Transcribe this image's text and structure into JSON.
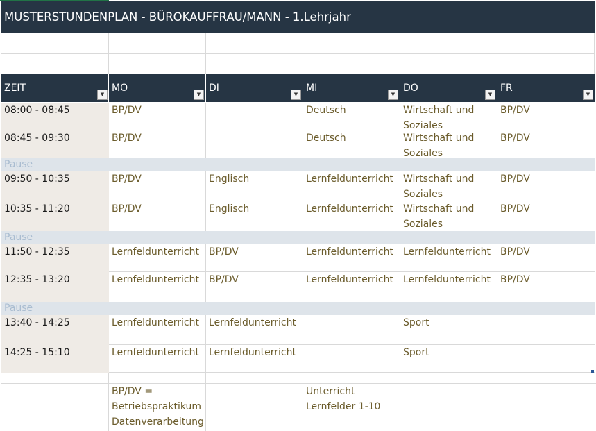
{
  "title": "MUSTERSTUNDENPLAN - BÜROKAUFFRAU/MANN - 1.Lehrjahr",
  "columns": [
    "ZEIT",
    "MO",
    "DI",
    "MI",
    "DO",
    "FR"
  ],
  "filter_glyph": "▼",
  "rows": [
    {
      "time": "08:00 - 08:45",
      "mo": "BP/DV",
      "di": "",
      "mi": "Deutsch",
      "do": [
        "Wirtschaft und",
        "Soziales"
      ],
      "fr": "BP/DV"
    },
    {
      "time": "08:45 - 09:30",
      "mo": "BP/DV",
      "di": "",
      "mi": "Deutsch",
      "do": [
        "Wirtschaft und",
        "Soziales"
      ],
      "fr": "BP/DV"
    },
    {
      "pause": "Pause"
    },
    {
      "time": "09:50 - 10:35",
      "mo": "BP/DV",
      "di": "Englisch",
      "mi": "Lernfeldunterricht",
      "do": [
        "Wirtschaft und",
        "Soziales"
      ],
      "fr": "BP/DV"
    },
    {
      "time": "10:35 - 11:20",
      "mo": "BP/DV",
      "di": "Englisch",
      "mi": "Lernfeldunterricht",
      "do": [
        "Wirtschaft und",
        "Soziales"
      ],
      "fr": "BP/DV"
    },
    {
      "pause": "Pause"
    },
    {
      "time": "11:50 - 12:35",
      "mo": "Lernfeldunterricht",
      "di": "BP/DV",
      "mi": "Lernfeldunterricht",
      "do": [
        "Lernfeldunterricht"
      ],
      "fr": "BP/DV"
    },
    {
      "time": "12:35 - 13:20",
      "mo": "Lernfeldunterricht",
      "di": "BP/DV",
      "mi": "Lernfeldunterricht",
      "do": [
        "Lernfeldunterricht"
      ],
      "fr": "BP/DV"
    },
    {
      "pause": "Pause"
    },
    {
      "time": "13:40 - 14:25",
      "mo": "Lernfeldunterricht",
      "di": "Lernfeldunterricht",
      "mi": "",
      "do": [
        "Sport"
      ],
      "fr": ""
    },
    {
      "time": "14:25 - 15:10",
      "mo": "Lernfeldunterricht",
      "di": "Lernfeldunterricht",
      "mi": "",
      "do": [
        "Sport"
      ],
      "fr": ""
    }
  ],
  "notes": {
    "mo": [
      "BP/DV =",
      "Betriebspraktikum",
      "Datenverarbeitung"
    ],
    "mi": [
      "Unterricht",
      "Lernfelder 1-10"
    ]
  },
  "colors": {
    "header_bg": "#263544",
    "header_text": "#ffffff",
    "time_column_bg": "#efebe6",
    "pause_band": "#dee4ea",
    "pause_text": "#a9bcd0",
    "subject_text": "#6b5c2c",
    "time_text": "#1a1a1a"
  }
}
